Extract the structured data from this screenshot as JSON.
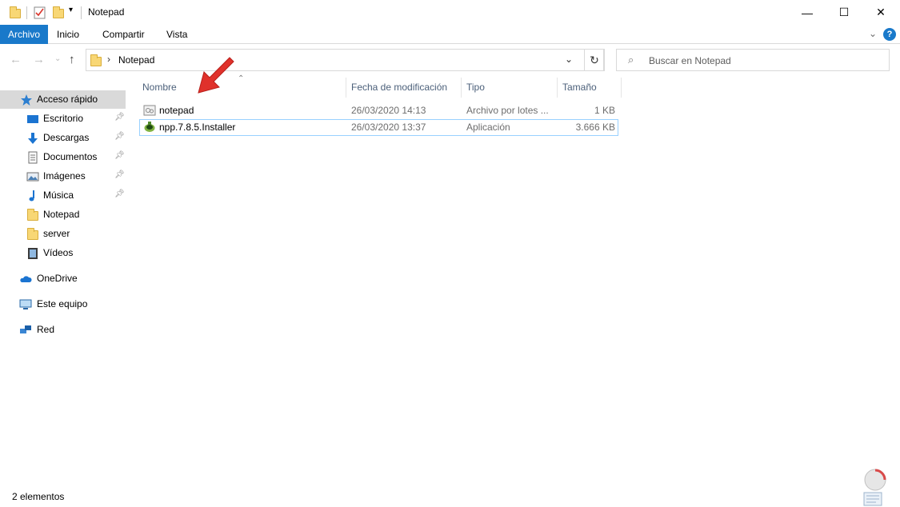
{
  "window": {
    "title": "Notepad",
    "controls": {
      "minimize": "—",
      "maximize": "☐",
      "close": "✕"
    }
  },
  "ribbon": {
    "tabs": [
      {
        "label": "Archivo",
        "active": true
      },
      {
        "label": "Inicio"
      },
      {
        "label": "Compartir"
      },
      {
        "label": "Vista"
      }
    ],
    "help_label": "?"
  },
  "address_bar": {
    "breadcrumb": [
      "Notepad"
    ],
    "separator": "›"
  },
  "search": {
    "placeholder": "Buscar en Notepad"
  },
  "sidebar": {
    "items": [
      {
        "label": "Acceso rápido",
        "icon": "star-icon"
      },
      {
        "label": "Escritorio",
        "icon": "desktop-icon",
        "pinned": true
      },
      {
        "label": "Descargas",
        "icon": "download-icon",
        "pinned": true
      },
      {
        "label": "Documentos",
        "icon": "document-icon",
        "pinned": true
      },
      {
        "label": "Imágenes",
        "icon": "image-icon",
        "pinned": true
      },
      {
        "label": "Música",
        "icon": "music-icon",
        "pinned": true
      },
      {
        "label": "Notepad",
        "icon": "folder-icon"
      },
      {
        "label": "server",
        "icon": "folder-icon"
      },
      {
        "label": "Vídeos",
        "icon": "video-icon"
      },
      {
        "label": "OneDrive",
        "icon": "cloud-icon"
      },
      {
        "label": "Este equipo",
        "icon": "computer-icon"
      },
      {
        "label": "Red",
        "icon": "network-icon"
      }
    ]
  },
  "columns": [
    "Nombre",
    "Fecha de modificación",
    "Tipo",
    "Tamaño"
  ],
  "files": [
    {
      "name": "notepad",
      "modified": "26/03/2020 14:13",
      "type": "Archivo por lotes ...",
      "size": "1 KB",
      "icon": "batch-file-icon"
    },
    {
      "name": "npp.7.8.5.Installer",
      "modified": "26/03/2020 13:37",
      "type": "Aplicación",
      "size": "3.666 KB",
      "icon": "installer-icon"
    }
  ],
  "status": {
    "count": "2 elementos"
  },
  "colors": {
    "accent": "#1979ca",
    "selection": "#cce8ff",
    "folder": "#f8d775",
    "arrow": "#e0312b"
  }
}
